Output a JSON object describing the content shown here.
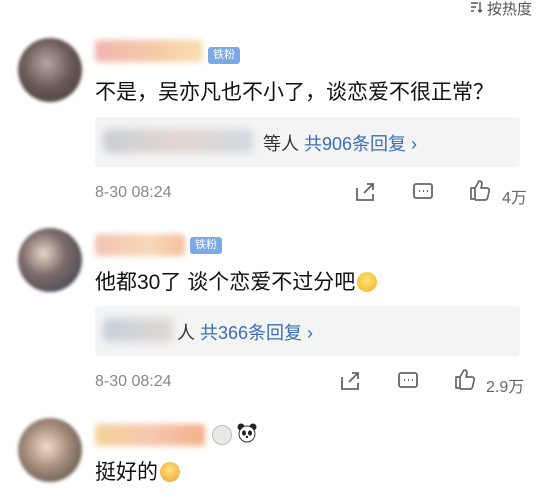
{
  "sort": {
    "label": "按热度"
  },
  "comments": [
    {
      "badge": "铁粉",
      "text": "不是，吴亦凡也不小了，谈恋爱不很正常？",
      "reply_prefix": "等人",
      "reply_count": "共906条回复 ›",
      "time": "8-30 08:24",
      "likes": "4万"
    },
    {
      "badge": "铁粉",
      "text": "他都30了 谈个恋爱不过分吧",
      "reply_prefix": "人",
      "reply_count": "共366条回复 ›",
      "time": "8-30 08:24",
      "likes": "2.9万"
    },
    {
      "text": "挺好的"
    }
  ],
  "colors": {
    "badge": "#7aa9e6",
    "reply_link": "#3a6fb5",
    "reply_bg": "#f4f4f4"
  },
  "icons": [
    "sort-icon",
    "share-icon",
    "comment-icon",
    "like-icon",
    "emoji-icon",
    "panda-icon"
  ]
}
